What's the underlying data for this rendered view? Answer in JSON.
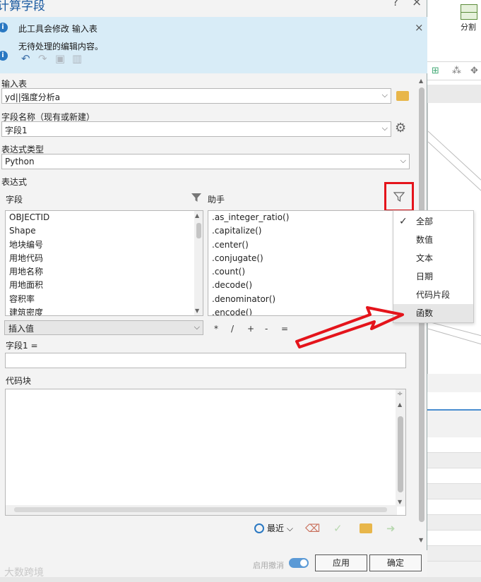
{
  "dialog": {
    "title": "计算字段",
    "help": "?",
    "close": "×"
  },
  "messages": {
    "modify_notice": "此工具会修改 输入表",
    "no_pending_edits": "无待处理的编辑内容。",
    "close": "×"
  },
  "form": {
    "input_table_label": "输入表",
    "input_table_value": "yd||强度分析a",
    "field_name_label": "字段名称（现有或新建）",
    "field_name_value": "字段1",
    "expression_type_label": "表达式类型",
    "expression_type_value": "Python",
    "expression_label": "表达式",
    "fields_header": "字段",
    "helpers_header": "助手",
    "insert_value": "插入值",
    "expression_prefix": "字段1 =",
    "code_block_label": "代码块"
  },
  "fields": [
    "OBJECTID",
    "Shape",
    "地块编号",
    "用地代码",
    "用地名称",
    "用地面积",
    "容积率",
    "建筑密度"
  ],
  "helpers": [
    ".as_integer_ratio()",
    ".capitalize()",
    ".center()",
    ".conjugate()",
    ".count()",
    ".decode()",
    ".denominator()",
    ".encode()"
  ],
  "operators": [
    "*",
    "/",
    "+",
    "-",
    "="
  ],
  "filter_menu": {
    "items": [
      "全部",
      "数值",
      "文本",
      "日期",
      "代码片段",
      "函数"
    ],
    "checked": "全部",
    "highlighted": "函数"
  },
  "bottom": {
    "recent": "最近",
    "enable_undo": "启用撤消",
    "apply": "应用",
    "ok": "确定",
    "watermark": "大数跨境"
  },
  "background": {
    "split_label": "分割"
  },
  "colors": {
    "accent": "#2a78c2",
    "highlight_box": "#e4141b",
    "info_bar": "#d8ecf7"
  }
}
